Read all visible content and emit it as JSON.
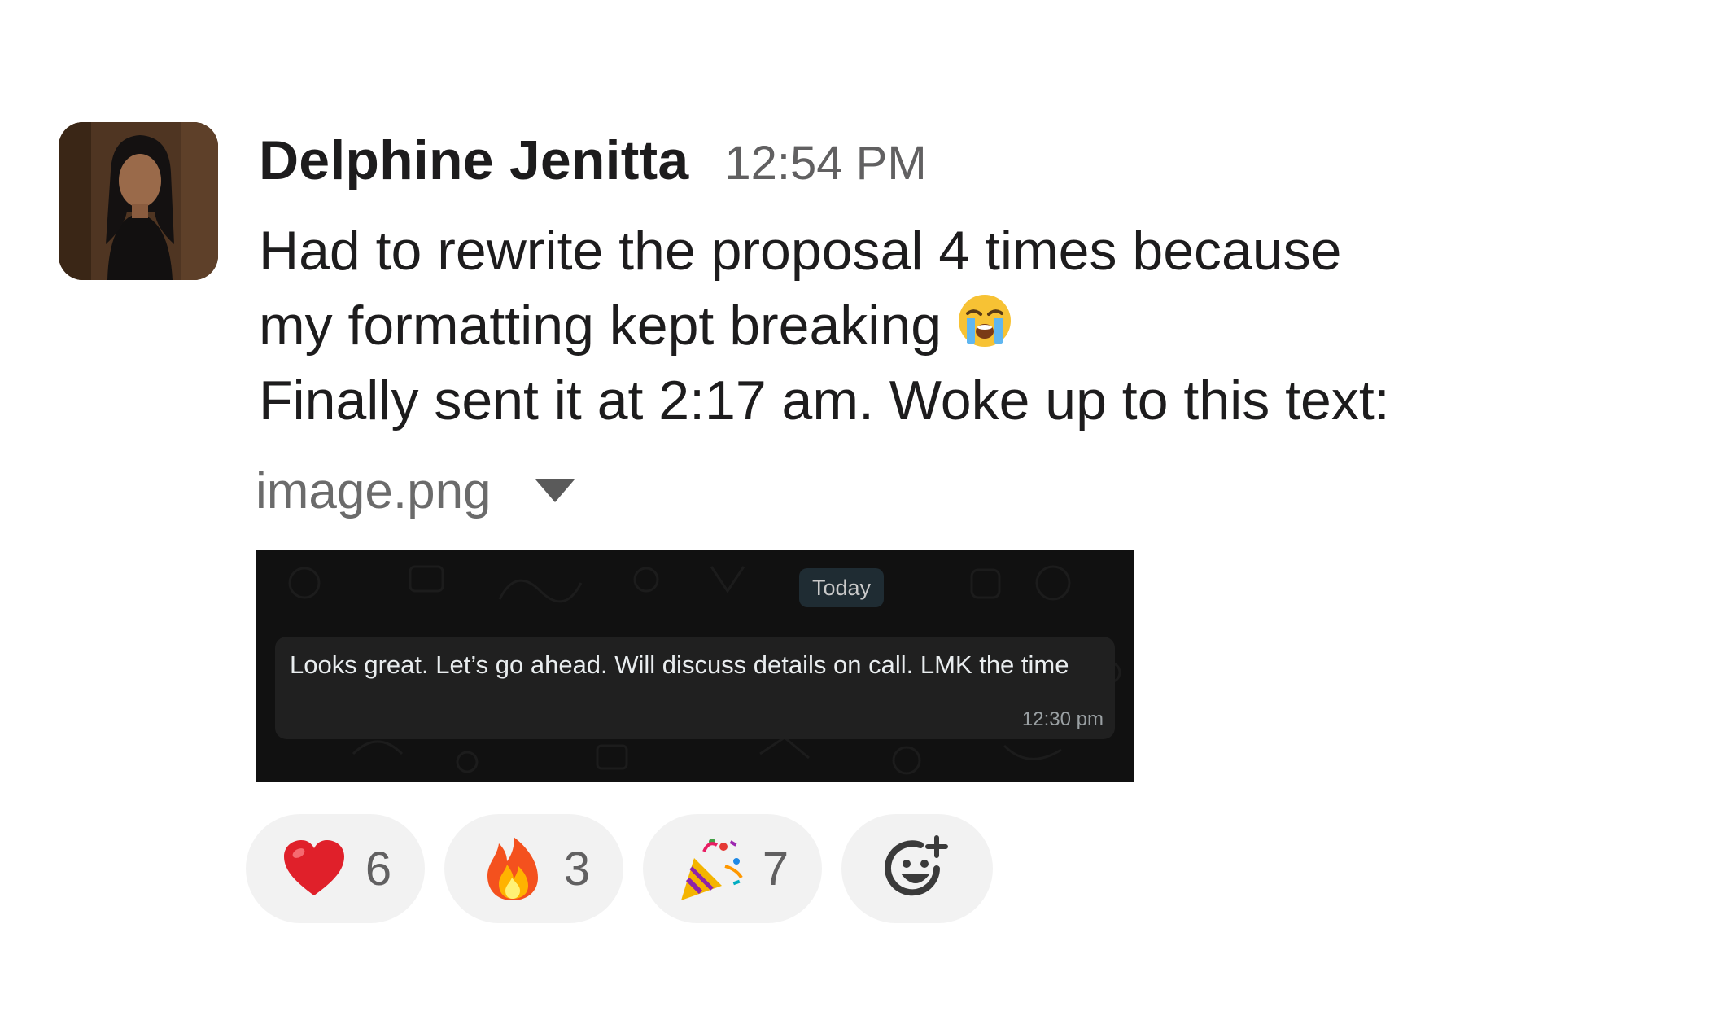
{
  "message": {
    "sender": "Delphine Jenitta",
    "timestamp": "12:54 PM",
    "lines": [
      "Had to rewrite the proposal 4 times because",
      "my formatting kept breaking",
      "Finally sent it at 2:17 am. Woke up to this text:"
    ],
    "inline_emoji": "loudly-crying-face"
  },
  "attachment": {
    "file_name": "image.png",
    "day_label": "Today",
    "bubble_text": "Looks great. Let’s go ahead. Will discuss details on call. LMK the time",
    "bubble_time": "12:30 pm",
    "background_color": "#111111"
  },
  "reactions": [
    {
      "emoji": "red-heart",
      "count": "6"
    },
    {
      "emoji": "fire",
      "count": "3"
    },
    {
      "emoji": "party-popper",
      "count": "7"
    }
  ],
  "add_reaction_icon": "add-reaction-icon",
  "colors": {
    "text": "#1d1c1d",
    "muted": "#616061",
    "pill": "#f2f2f2"
  }
}
